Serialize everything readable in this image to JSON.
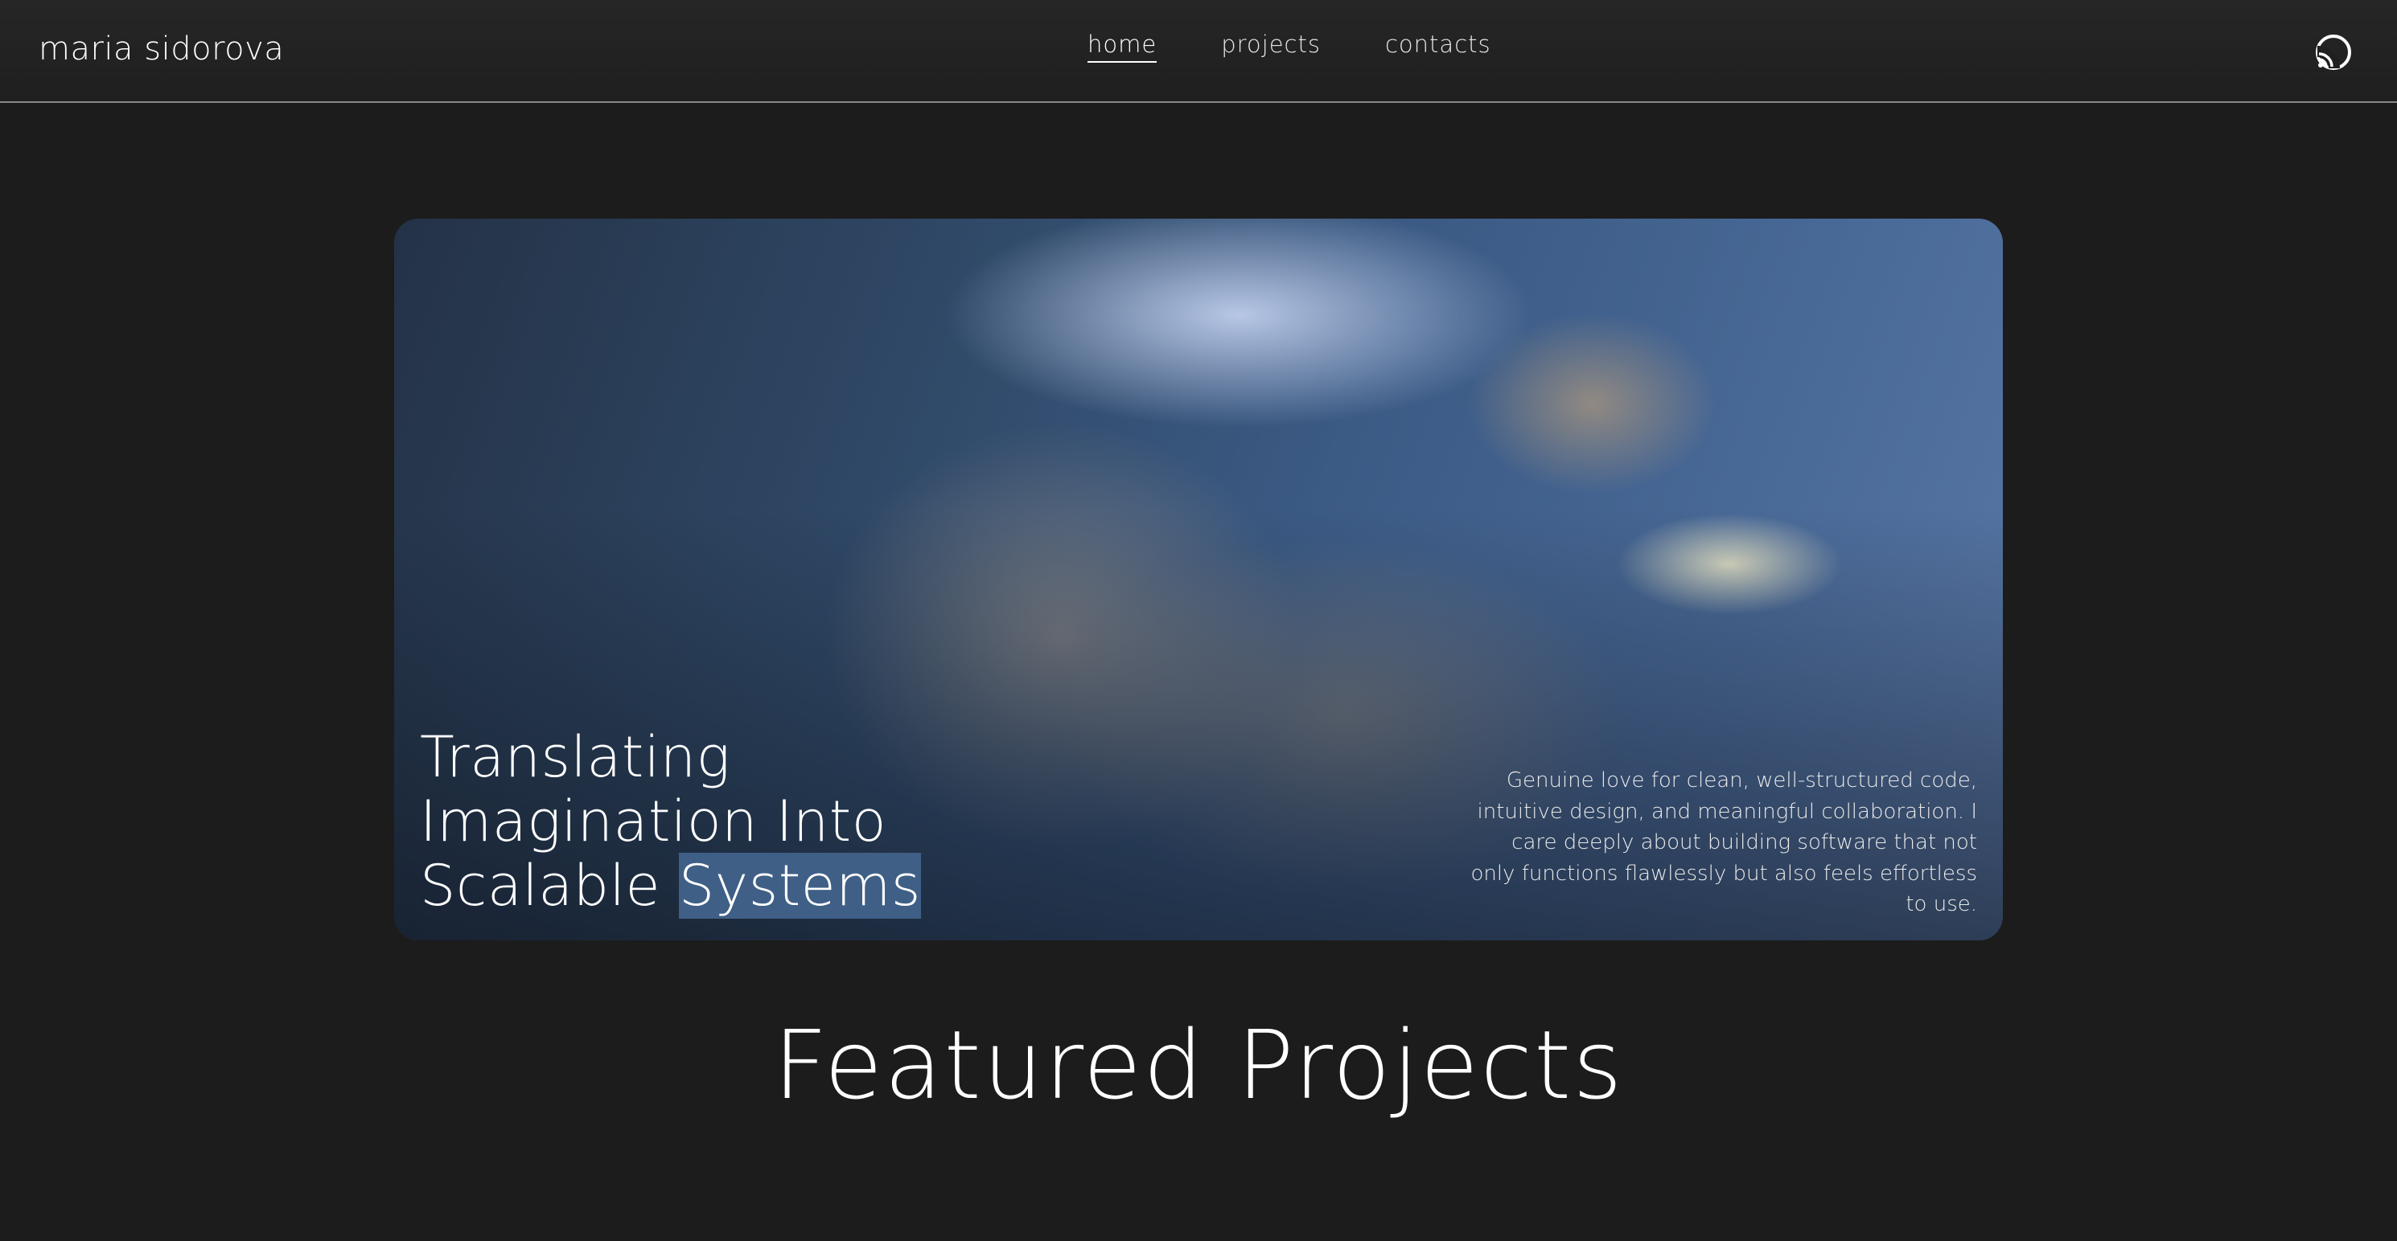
{
  "header": {
    "brand": "maria sidorova",
    "nav": [
      {
        "label": "home",
        "active": true
      },
      {
        "label": "projects",
        "active": false
      },
      {
        "label": "contacts",
        "active": false
      }
    ],
    "cast_icon": "cast-icon"
  },
  "hero": {
    "title_lines": [
      "Translating",
      "Imagination Into",
      "Scalable "
    ],
    "title_highlight": "Systems",
    "description": "Genuine love for clean, well-structured code, intuitive design, and meaningful collaboration. I care deeply about building software that not only functions flawlessly but also feels effortless to use.",
    "image": "portrait-photo"
  },
  "featured": {
    "title": "Featured Projects"
  },
  "colors": {
    "background": "#1c1c1c",
    "highlight": "#3f5f86",
    "text": "#ffffff"
  }
}
